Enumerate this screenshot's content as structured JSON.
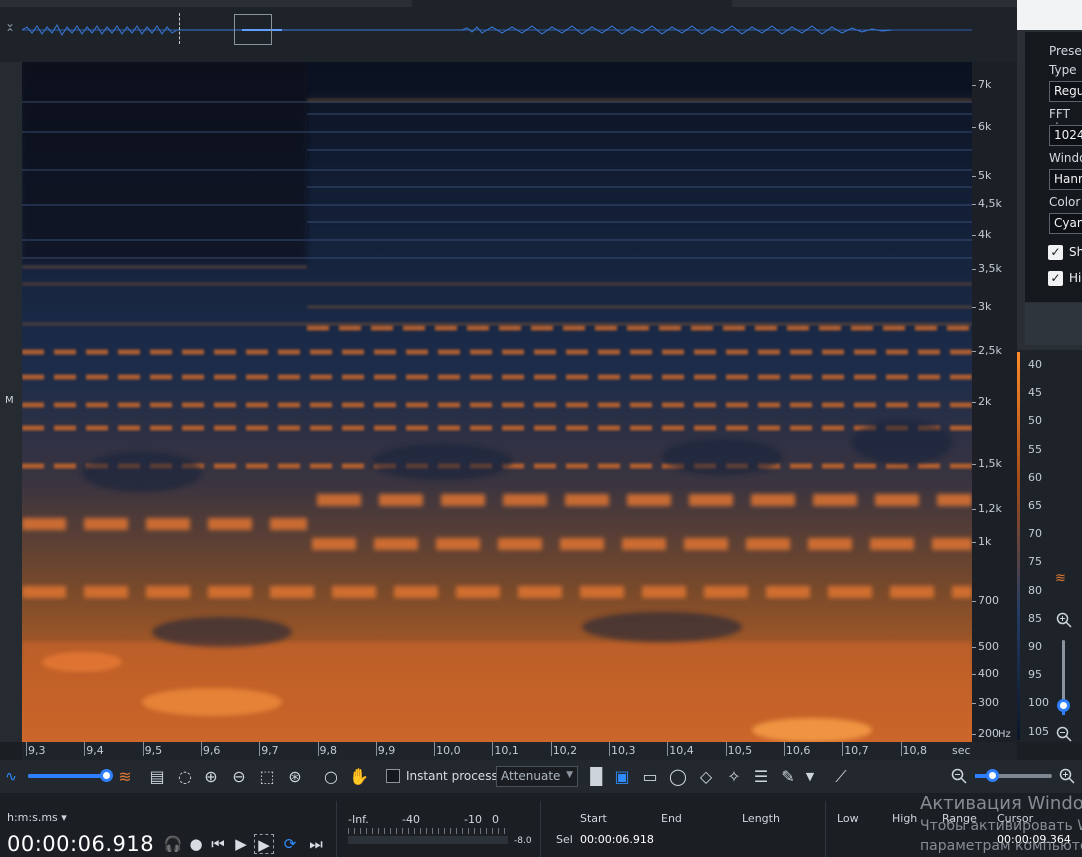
{
  "track": {
    "channel_label": "M"
  },
  "frequency_axis": {
    "labels": [
      "7k",
      "6k",
      "5k",
      "4,5k",
      "4k",
      "3,5k",
      "3k",
      "2,5k",
      "2k",
      "1,5k",
      "1,2k",
      "1k",
      "700",
      "500",
      "400",
      "300",
      "200"
    ],
    "unit": "Hz"
  },
  "time_axis": {
    "labels": [
      "9,3",
      "9,4",
      "9,5",
      "9,6",
      "9,7",
      "9,8",
      "9,9",
      "10,0",
      "10,1",
      "10,2",
      "10,3",
      "10,4",
      "10,5",
      "10,6",
      "10,7",
      "10,8"
    ],
    "unit": "sec"
  },
  "db_scale": {
    "labels": [
      "40",
      "45",
      "50",
      "55",
      "60",
      "65",
      "70",
      "75",
      "80",
      "85",
      "90",
      "95",
      "100",
      "105"
    ]
  },
  "settings": {
    "preset_label": "Preset",
    "type_label": "Type",
    "type_value": "Regu",
    "fft_label": "FFT si",
    "fft_value": "1024",
    "window_label": "Windo",
    "window_value": "Hann",
    "color_label": "Color",
    "color_value": "Cyan",
    "check1_label": "Sh",
    "check2_label": "Hi"
  },
  "toolbar": {
    "instant_process_label": "Instant process",
    "attenuate_value": "Attenuate"
  },
  "transport": {
    "time_format": "h:m:s.ms",
    "time_value": "00:00:06.918"
  },
  "meter": {
    "labels": [
      "-Inf.",
      "-40",
      "-10",
      "0"
    ],
    "value": "-8.0"
  },
  "selection": {
    "headers": [
      "Start",
      "End",
      "Length",
      "Low",
      "High",
      "Range",
      "Cursor"
    ],
    "row_label": "Sel",
    "start": "00:00:06.918",
    "cursor": "00:00:09.364"
  },
  "watermark": {
    "line1": "Активация Windo",
    "line2": "Чтобы активировать W",
    "line3": "параметрам компьюте"
  },
  "colors": {
    "accent": "#2f7fff",
    "spectrogram_low": "#10192b",
    "spectrogram_high": "#e8742a"
  }
}
